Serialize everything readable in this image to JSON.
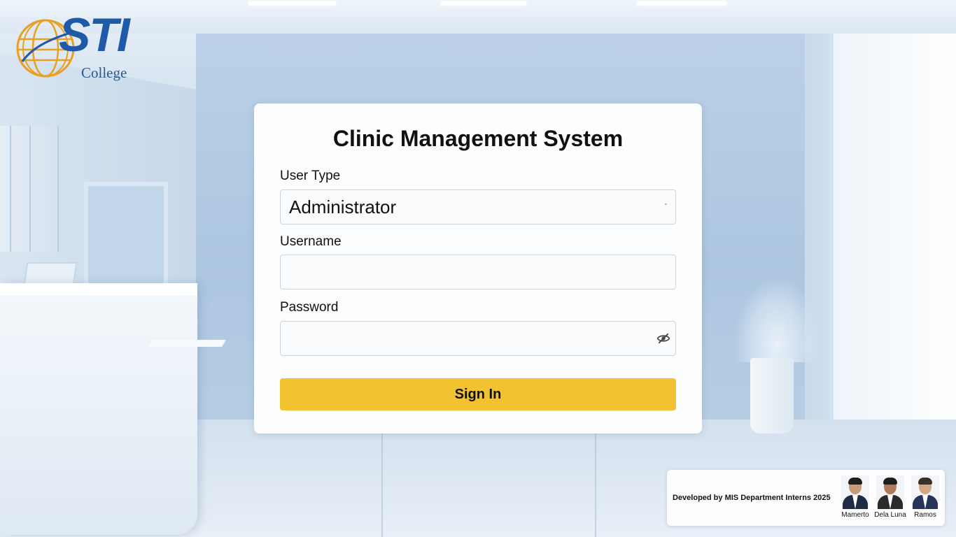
{
  "logo": {
    "brand": "STI",
    "sub": "College"
  },
  "login": {
    "title": "Clinic Management System",
    "user_type_label": "User Type",
    "user_type_value": "Administrator",
    "username_label": "Username",
    "username_value": "",
    "password_label": "Password",
    "password_value": "",
    "sign_in_label": "Sign In"
  },
  "credits": {
    "text": "Developed by MIS Department Interns 2025",
    "developers": [
      {
        "name": "Mamerto"
      },
      {
        "name": "Dela Luna"
      },
      {
        "name": "Ramos"
      }
    ]
  },
  "colors": {
    "accent": "#f2c230",
    "brand_blue": "#1f5aa8",
    "brand_orange": "#e8a020"
  }
}
